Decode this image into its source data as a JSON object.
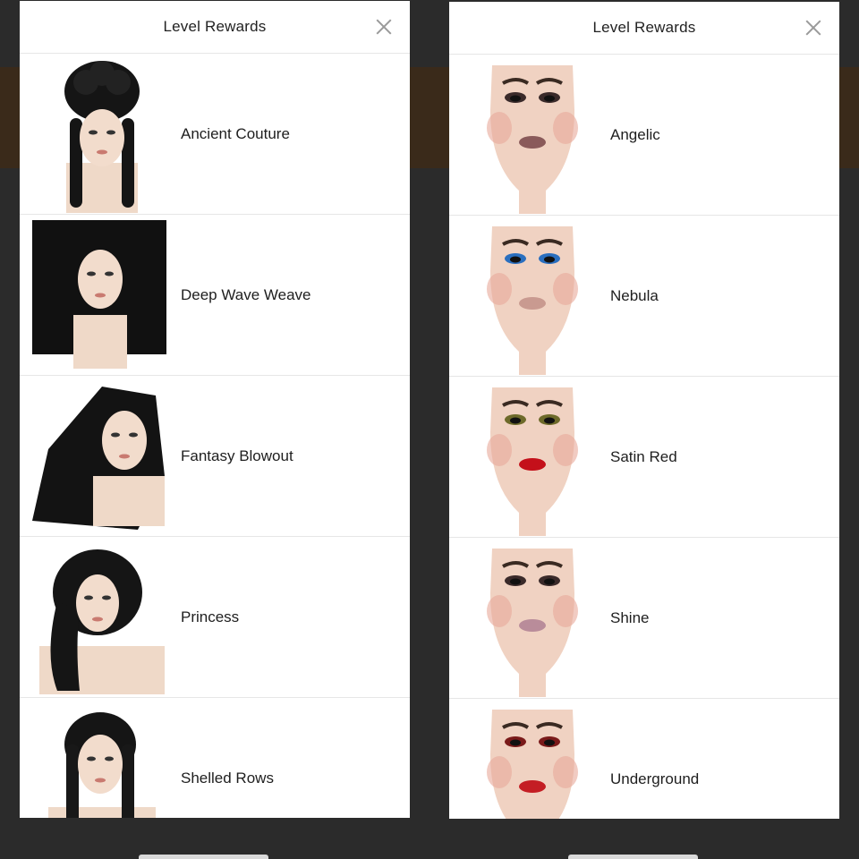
{
  "colors": {
    "backdrop": "#2b2b2b",
    "panel": "#ffffff",
    "divider": "#e6e6e6",
    "text": "#1e1e1e",
    "close_icon": "#9a9a9a"
  },
  "left_panel": {
    "title": "Level Rewards",
    "close_icon": "close-icon",
    "items": [
      {
        "label": "Ancient Couture",
        "image": "hairstyle-updo"
      },
      {
        "label": "Deep Wave Weave",
        "image": "hairstyle-curly"
      },
      {
        "label": "Fantasy Blowout",
        "image": "hairstyle-blowout"
      },
      {
        "label": "Princess",
        "image": "hairstyle-princess"
      },
      {
        "label": "Shelled Rows",
        "image": "hairstyle-braids"
      }
    ]
  },
  "right_panel": {
    "title": "Level Rewards",
    "close_icon": "close-icon",
    "items": [
      {
        "label": "Angelic",
        "image": "makeup-face",
        "lip": "#8a5a5a",
        "eye": "#3a2a2a"
      },
      {
        "label": "Nebula",
        "image": "makeup-face",
        "lip": "#c99a90",
        "eye": "#2a6fbf"
      },
      {
        "label": "Satin Red",
        "image": "makeup-face",
        "lip": "#c4101a",
        "eye": "#6d6a2a"
      },
      {
        "label": "Shine",
        "image": "makeup-face",
        "lip": "#b98c9a",
        "eye": "#3a2a2a"
      },
      {
        "label": "Underground",
        "image": "makeup-face",
        "lip": "#c41e24",
        "eye": "#7a1a1a"
      }
    ]
  }
}
